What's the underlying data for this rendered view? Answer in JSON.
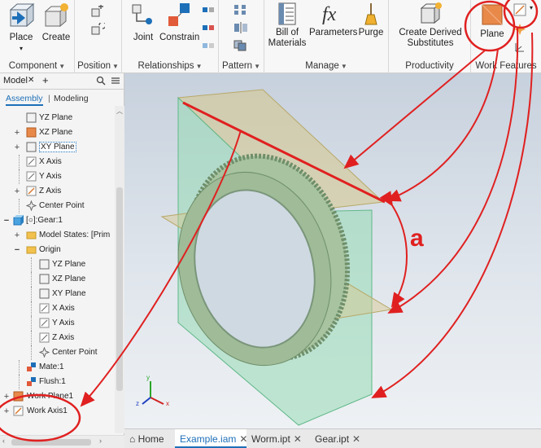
{
  "ribbon": {
    "component": {
      "title": "Component",
      "place_label": "Place",
      "create_label": "Create"
    },
    "position": {
      "title": "Position"
    },
    "relationships": {
      "title": "Relationships",
      "joint_label": "Joint",
      "constrain_label": "Constrain"
    },
    "pattern": {
      "title": "Pattern"
    },
    "manage": {
      "title": "Manage",
      "bom_line1": "Bill of",
      "bom_line2": "Materials",
      "parameters_label": "Parameters",
      "purge_label": "Purge"
    },
    "productivity": {
      "title": "Productivity",
      "cds_line1": "Create Derived",
      "cds_line2": "Substitutes"
    },
    "work_features": {
      "title": "Work Features",
      "plane_label": "Plane"
    }
  },
  "browser": {
    "tab_model": "Model",
    "tab_close": "✕",
    "tab_add": "+",
    "mode_assembly": "Assembly",
    "mode_separator": "|",
    "mode_modeling": "Modeling",
    "tree": [
      {
        "label": "YZ Plane",
        "icon": "plane-icon",
        "expander": ""
      },
      {
        "label": "XZ Plane",
        "icon": "plane-icon",
        "expander": "+"
      },
      {
        "label": "XY Plane",
        "icon": "plane-icon",
        "expander": "+"
      },
      {
        "label": "X Axis",
        "icon": "axis-icon",
        "expander": ""
      },
      {
        "label": "Y Axis",
        "icon": "axis-icon",
        "expander": ""
      },
      {
        "label": "Z Axis",
        "icon": "axis-icon",
        "expander": "+"
      },
      {
        "label": "Center Point",
        "icon": "point-icon",
        "expander": ""
      },
      {
        "label": "[○]:Gear:1",
        "icon": "part-icon",
        "expander": "−"
      },
      {
        "label": "Model States: [Prim",
        "icon": "folder-icon",
        "expander": "+"
      },
      {
        "label": "Origin",
        "icon": "folder-icon",
        "expander": "−"
      },
      {
        "label": "YZ Plane",
        "icon": "plane-icon",
        "expander": ""
      },
      {
        "label": "XZ Plane",
        "icon": "plane-icon",
        "expander": ""
      },
      {
        "label": "XY Plane",
        "icon": "plane-icon",
        "expander": ""
      },
      {
        "label": "X Axis",
        "icon": "axis-icon",
        "expander": ""
      },
      {
        "label": "Y Axis",
        "icon": "axis-icon",
        "expander": ""
      },
      {
        "label": "Z Axis",
        "icon": "axis-icon",
        "expander": ""
      },
      {
        "label": "Center Point",
        "icon": "point-icon",
        "expander": ""
      },
      {
        "label": "Mate:1",
        "icon": "constraint-icon",
        "expander": ""
      },
      {
        "label": "Flush:1",
        "icon": "constraint-icon",
        "expander": ""
      },
      {
        "label": "Work Plane1",
        "icon": "work-plane-icon",
        "expander": "+"
      },
      {
        "label": "Work Axis1",
        "icon": "work-axis-icon",
        "expander": "+"
      }
    ]
  },
  "viewport": {
    "annotation_label": "a"
  },
  "doc_tabs": [
    {
      "label": "Home",
      "close": ""
    },
    {
      "label": "Example.iam",
      "close": "✕"
    },
    {
      "label": "Worm.ipt",
      "close": "✕"
    },
    {
      "label": "Gear.ipt",
      "close": "✕"
    }
  ],
  "colors": {
    "accent": "#1d6fb8",
    "annotation_red": "#e02020",
    "plane_fill": "#8fd9b0",
    "gear_fill": "#a7c3a0"
  }
}
